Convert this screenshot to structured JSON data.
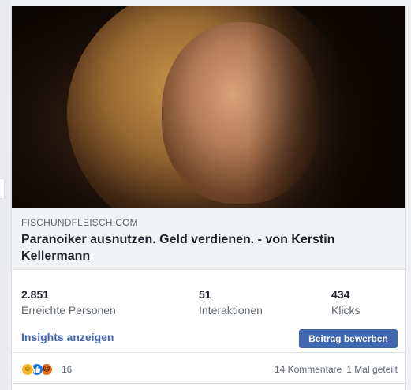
{
  "link_preview": {
    "domain": "FISCHUNDFLEISCH.COM",
    "title": "Paranoiker ausnutzen. Geld verdienen. - von Kerstin Kellermann"
  },
  "stats": [
    {
      "value": "2.851",
      "label": "Erreichte Personen"
    },
    {
      "value": "51",
      "label": "Interaktionen"
    },
    {
      "value": "434",
      "label": "Klicks"
    }
  ],
  "actions": {
    "insights_label": "Insights anzeigen",
    "promote_label": "Beitrag bewerben"
  },
  "reactions": {
    "icons": [
      "haha-icon",
      "like-icon",
      "angry-icon"
    ],
    "count": "16",
    "comments": "14 Kommentare",
    "shares": "1 Mal geteilt"
  },
  "colors": {
    "link_blue": "#4267b2",
    "button_blue": "#4267b2",
    "meta_gray": "#606770"
  }
}
